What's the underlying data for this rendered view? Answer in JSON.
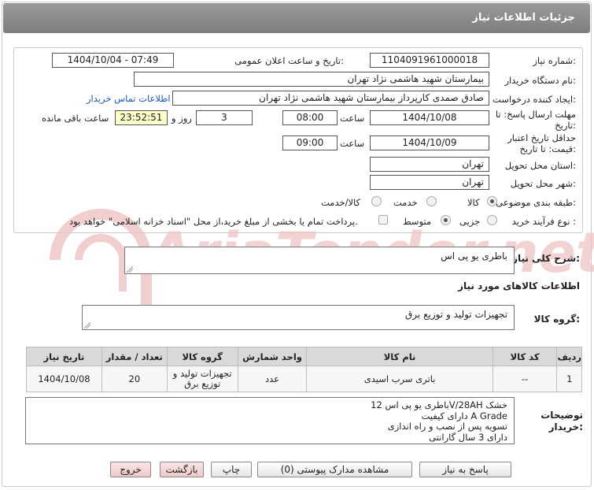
{
  "header": {
    "title": "جزئیات اطلاعات نیاز"
  },
  "fields": {
    "need_number_label": "شماره نیاز:",
    "need_number": "1104091961000018",
    "announce_label": "تاریخ و ساعت اعلان عمومی:",
    "announce_value": "1404/10/04 - 07:49",
    "buyer_org_label": "نام دستگاه خریدار:",
    "buyer_org": "بیمارستان شهید هاشمی نژاد تهران",
    "creator_label": "ایجاد کننده درخواست:",
    "creator": "صادق صمدی کارپرداز بیمارستان شهید هاشمی نژاد تهران",
    "contact_link": "اطلاعات تماس خریدار",
    "deadline_label_1": "مهلت ارسال پاسخ: تا",
    "deadline_label_2": "تاریخ:",
    "deadline_date": "1404/10/08",
    "time_label": "ساعت",
    "deadline_time": "08:00",
    "days_value": "3",
    "days_label": "روز و",
    "remaining_time": "23:52:51",
    "remaining_label": "ساعت باقی مانده",
    "validity_label_1": "حداقل تاریخ اعتبار",
    "validity_label_2": "قیمت: تا تاریخ:",
    "validity_date": "1404/10/09",
    "validity_time": "09:00",
    "province_label": "استان محل تحویل:",
    "province": "تهران",
    "city_label": "شهر محل تحویل:",
    "city": "تهران",
    "category_label": "طبقه بندی موضوعی:",
    "category_options": [
      "کالا",
      "خدمت",
      "کالا/خدمت"
    ],
    "process_label": "نوع فرآیند خرید :",
    "process_options": [
      "جزیی",
      "متوسط"
    ],
    "payment_note": "پرداخت تمام یا بخشی از مبلغ خرید،از محل \"اسناد خزانه اسلامی\" خواهد بود."
  },
  "description": {
    "label": "شرح کلی نیاز:",
    "value": "باطری یو پی اس"
  },
  "goods_info_title": "اطلاعات کالاهای مورد نیاز",
  "goods_group": {
    "label": "گروه کالا:",
    "value": "تجهیزات تولید و توزیع برق"
  },
  "table": {
    "headers": [
      "ردیف",
      "کد کالا",
      "نام کالا",
      "واحد شمارش",
      "گروه کالا",
      "تعداد / مقدار",
      "تاریخ نیاز"
    ],
    "rows": [
      [
        "1",
        "--",
        "باتری سرب اسیدی",
        "عدد",
        "تجهیزات تولید و توزیع برق",
        "20",
        "1404/10/08"
      ]
    ]
  },
  "buyer_notes": {
    "label_1": "توضیحات",
    "label_2": "خریدار:",
    "lines": [
      "باطری یو پی اس 12V/28AH خشک",
      "دارای کیفیت  A  Grade",
      "تسویه پس از نصب و  راه اندازی",
      "دارای 3 سال گارانتی"
    ]
  },
  "buttons": {
    "reply": "پاسخ به نیاز",
    "attachments": "مشاهده مدارک پیوستی (0)",
    "print": "چاپ",
    "back": "بازگشت",
    "exit": "خروج"
  },
  "watermark": {
    "text": "AriaTender.net"
  },
  "colors": {
    "header_bg": "#8b8b8b",
    "link": "#1a56c4",
    "yellow_box": "#ffffcc",
    "pink_button": "#f0caca",
    "watermark": "#e7b7b7"
  }
}
